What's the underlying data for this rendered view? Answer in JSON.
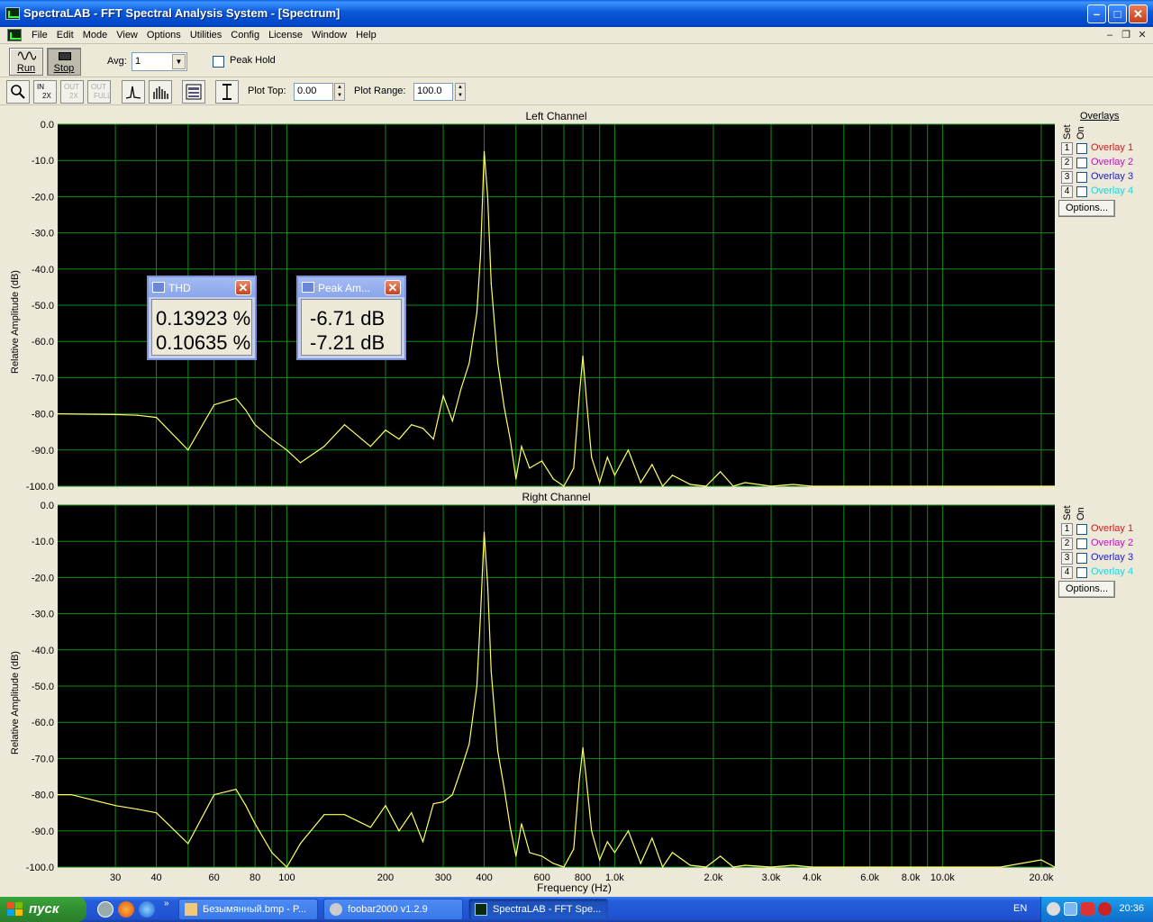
{
  "window": {
    "title": "SpectraLAB - FFT Spectral Analysis System - [Spectrum]"
  },
  "menu": [
    "File",
    "Edit",
    "Mode",
    "View",
    "Options",
    "Utilities",
    "Config",
    "License",
    "Window",
    "Help"
  ],
  "toolbar": {
    "run_label": "Run",
    "stop_label": "Stop",
    "avg_label": "Avg:",
    "avg_value": "1",
    "peak_hold_label": "Peak Hold",
    "peak_hold_checked": false,
    "zoom_in_text": "IN",
    "zoom_in_factor": "2X",
    "zoom_out_text": "OUT",
    "zoom_out_factor": "2X",
    "zoom_out_full_text": "OUT",
    "zoom_full_text": "FULL",
    "plot_top_label": "Plot Top:",
    "plot_top_value": "0.00",
    "plot_range_label": "Plot Range:",
    "plot_range_value": "100.0"
  },
  "overlays": {
    "header": "Overlays",
    "set_label": "Set",
    "on_label": "On",
    "items": [
      {
        "num": "1",
        "label": "Overlay 1",
        "color": "#d01c1c"
      },
      {
        "num": "2",
        "label": "Overlay 2",
        "color": "#c010c0"
      },
      {
        "num": "3",
        "label": "Overlay 3",
        "color": "#1c1cc8"
      },
      {
        "num": "4",
        "label": "Overlay 4",
        "color": "#18d8e0"
      }
    ],
    "options_label": "Options..."
  },
  "readouts": {
    "thd": {
      "title": "THD",
      "values": [
        "0.13923 %",
        "0.10635 %"
      ]
    },
    "peak": {
      "title": "Peak Am...",
      "values": [
        "-6.71 dB",
        "-7.21 dB"
      ]
    }
  },
  "chart_data": [
    {
      "type": "line",
      "title": "Left Channel",
      "ylabel": "Relative Amplitude (dB)",
      "xlabel": "",
      "xscale": "log",
      "ylim": [
        -100,
        0
      ],
      "grid": true,
      "line_color": "#ffff66",
      "background": "#000000",
      "grid_color": "#148c14",
      "yticks": [
        "0.0",
        "-10.0",
        "-20.0",
        "-30.0",
        "-40.0",
        "-50.0",
        "-60.0",
        "-70.0",
        "-80.0",
        "-90.0",
        "-100.0"
      ],
      "x": [
        20,
        30,
        35,
        40,
        50,
        60,
        70,
        75,
        80,
        90,
        100,
        110,
        130,
        150,
        180,
        200,
        220,
        240,
        260,
        280,
        300,
        320,
        340,
        360,
        380,
        390,
        400,
        410,
        420,
        440,
        460,
        480,
        500,
        520,
        550,
        600,
        650,
        700,
        750,
        780,
        800,
        820,
        850,
        900,
        950,
        1000,
        1100,
        1200,
        1300,
        1400,
        1500,
        1700,
        1900,
        2100,
        2300,
        2500,
        3000,
        3500,
        4000,
        5000,
        6000,
        8000,
        10000,
        15000,
        20000,
        22000
      ],
      "y": [
        -80,
        -80.2,
        -80.4,
        -81,
        -90,
        -77.5,
        -75.7,
        -79,
        -83,
        -87,
        -90,
        -93.5,
        -89,
        -83,
        -89,
        -84.5,
        -87,
        -83,
        -84,
        -87,
        -75,
        -82,
        -73,
        -66,
        -52,
        -36,
        -7.5,
        -20,
        -44,
        -66,
        -78,
        -87,
        -98,
        -89,
        -95,
        -93,
        -98,
        -100,
        -95,
        -75,
        -64,
        -76,
        -92,
        -99,
        -92,
        -97,
        -90,
        -99,
        -94,
        -100,
        -97,
        -99.5,
        -100,
        -96,
        -100,
        -99,
        -100,
        -99.5,
        -100,
        -100,
        -100,
        -100,
        -100,
        -100,
        -100,
        -100
      ]
    },
    {
      "type": "line",
      "title": "Right Channel",
      "ylabel": "Relative Amplitude (dB)",
      "xlabel": "Frequency (Hz)",
      "xscale": "log",
      "ylim": [
        -100,
        0
      ],
      "grid": true,
      "line_color": "#ffff66",
      "background": "#000000",
      "grid_color": "#148c14",
      "yticks": [
        "0.0",
        "-10.0",
        "-20.0",
        "-30.0",
        "-40.0",
        "-50.0",
        "-60.0",
        "-70.0",
        "-80.0",
        "-90.0",
        "-100.0"
      ],
      "xticks": [
        "30",
        "40",
        "60",
        "80",
        "100",
        "200",
        "300",
        "400",
        "600",
        "800",
        "1.0k",
        "2.0k",
        "3.0k",
        "4.0k",
        "6.0k",
        "8.0k",
        "10.0k",
        "20.0k"
      ],
      "x": [
        20,
        22,
        30,
        35,
        40,
        50,
        60,
        70,
        75,
        80,
        90,
        100,
        110,
        130,
        150,
        180,
        200,
        220,
        240,
        260,
        280,
        300,
        320,
        340,
        360,
        380,
        390,
        400,
        410,
        420,
        440,
        460,
        480,
        500,
        520,
        550,
        600,
        650,
        700,
        750,
        780,
        800,
        820,
        850,
        900,
        950,
        1000,
        1100,
        1200,
        1300,
        1400,
        1500,
        1700,
        1900,
        2100,
        2300,
        2500,
        3000,
        3500,
        4000,
        5000,
        6000,
        8000,
        10000,
        15000,
        20000,
        22000
      ],
      "y": [
        -80,
        -80,
        -83,
        -84,
        -85,
        -93.5,
        -80,
        -78.5,
        -83,
        -88,
        -96,
        -100,
        -93.5,
        -85.5,
        -85.5,
        -89,
        -83,
        -90,
        -85,
        -93,
        -82.5,
        -82,
        -80,
        -73,
        -66,
        -50,
        -30,
        -7.5,
        -22,
        -46,
        -68,
        -78,
        -89,
        -97,
        -88,
        -96,
        -97,
        -99,
        -100,
        -95,
        -76,
        -67,
        -76,
        -90,
        -98,
        -93,
        -96,
        -90,
        -99,
        -92,
        -100,
        -96,
        -99.5,
        -100,
        -97,
        -100,
        -99.5,
        -100,
        -99.5,
        -100,
        -100,
        -100,
        -100,
        -100,
        -100,
        -98,
        -100
      ]
    }
  ],
  "taskbar": {
    "start_label": "пуск",
    "tasks": [
      "Безымянный.bmp - P...",
      "foobar2000 v1.2.9",
      "SpectraLAB - FFT Spe..."
    ],
    "lang": "EN",
    "clock": "20:36"
  }
}
